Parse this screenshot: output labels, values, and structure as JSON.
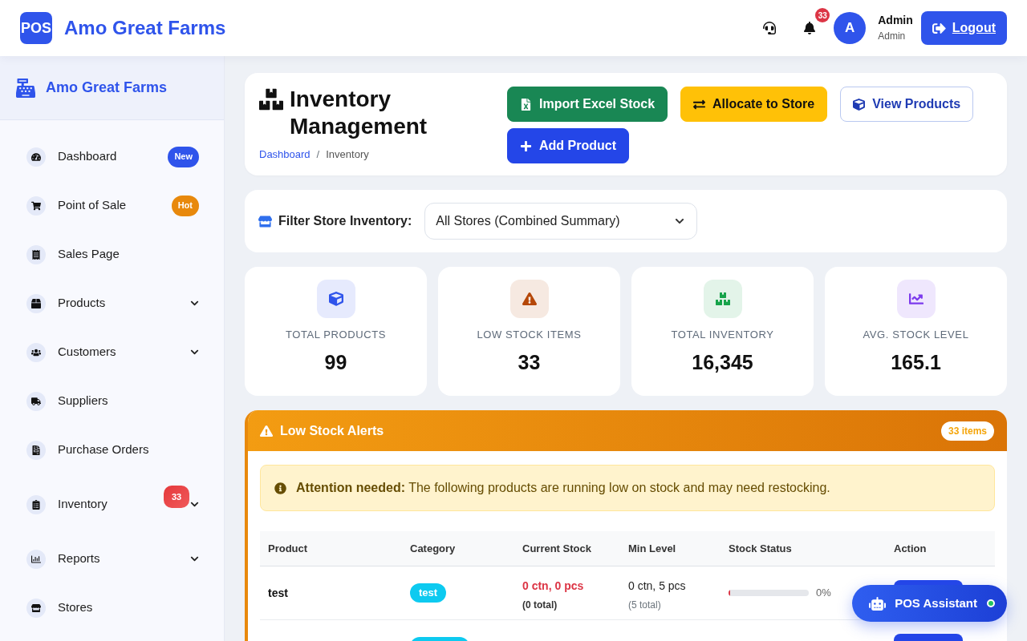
{
  "header": {
    "logo": "POS",
    "title": "Amo Great Farms",
    "notification_count": "33",
    "user": {
      "avatar": "A",
      "name": "Admin",
      "role": "Admin"
    },
    "logout": "Logout"
  },
  "sidebar": {
    "brand": "Amo Great Farms",
    "items": [
      {
        "label": "Dashboard",
        "has_submenu": false,
        "badge": {
          "text": "New",
          "color": "#2f54eb"
        }
      },
      {
        "label": "Point of Sale",
        "has_submenu": false,
        "badge": {
          "text": "Hot",
          "color": "#e8890c"
        }
      },
      {
        "label": "Sales Page",
        "has_submenu": false
      },
      {
        "label": "Products",
        "has_submenu": true
      },
      {
        "label": "Customers",
        "has_submenu": true
      },
      {
        "label": "Suppliers",
        "has_submenu": false
      },
      {
        "label": "Purchase Orders",
        "has_submenu": false
      },
      {
        "label": "Inventory",
        "has_submenu": true,
        "count": "33"
      },
      {
        "label": "Reports",
        "has_submenu": true
      },
      {
        "label": "Stores",
        "has_submenu": false
      }
    ]
  },
  "page": {
    "title": "Inventory Management",
    "breadcrumb_separator": "/",
    "breadcrumb": [
      {
        "label": "Dashboard",
        "selected": false
      },
      {
        "label": "Inventory",
        "selected": true
      }
    ],
    "actions": [
      {
        "label": "Import Excel Stock",
        "kind": "success"
      },
      {
        "label": "Allocate to Store",
        "kind": "warning"
      },
      {
        "label": "View Products",
        "kind": "outline"
      },
      {
        "label": "Add Product",
        "kind": "primary"
      }
    ]
  },
  "filter": {
    "label": "Filter Store Inventory:",
    "value": "All Stores (Combined Summary)"
  },
  "stats": [
    {
      "label": "TOTAL PRODUCTS",
      "value": "99",
      "color": "#2f54eb"
    },
    {
      "label": "LOW STOCK ITEMS",
      "value": "33",
      "color": "#b54708"
    },
    {
      "label": "TOTAL INVENTORY",
      "value": "16,345",
      "color": "#16a34a"
    },
    {
      "label": "AVG. STOCK LEVEL",
      "value": "165.1",
      "color": "#7c3aed"
    }
  ],
  "low_stock": {
    "title": "Low Stock Alerts",
    "count": "33 items",
    "alert": "**Attention needed:** The following products are running low on stock and may need restocking.",
    "columns": [
      "Product",
      "Category",
      "Current Stock",
      "Min Level",
      "Stock Status",
      "Action"
    ],
    "rows": [
      {
        "product": "test",
        "tagged": true,
        "category": "test",
        "current_stock": "0 ctn, 0 pcs",
        "current_total": "(0 total)",
        "min_level": "0 ctn, 5 pcs",
        "min_total": "(5 total)",
        "stock_status": {
          "level": 0,
          "reading": "0%"
        },
        "has_action": true
      },
      {
        "tagged": true,
        "has_action": true
      }
    ]
  },
  "assistant": {
    "label": "POS Assistant",
    "online": true
  }
}
